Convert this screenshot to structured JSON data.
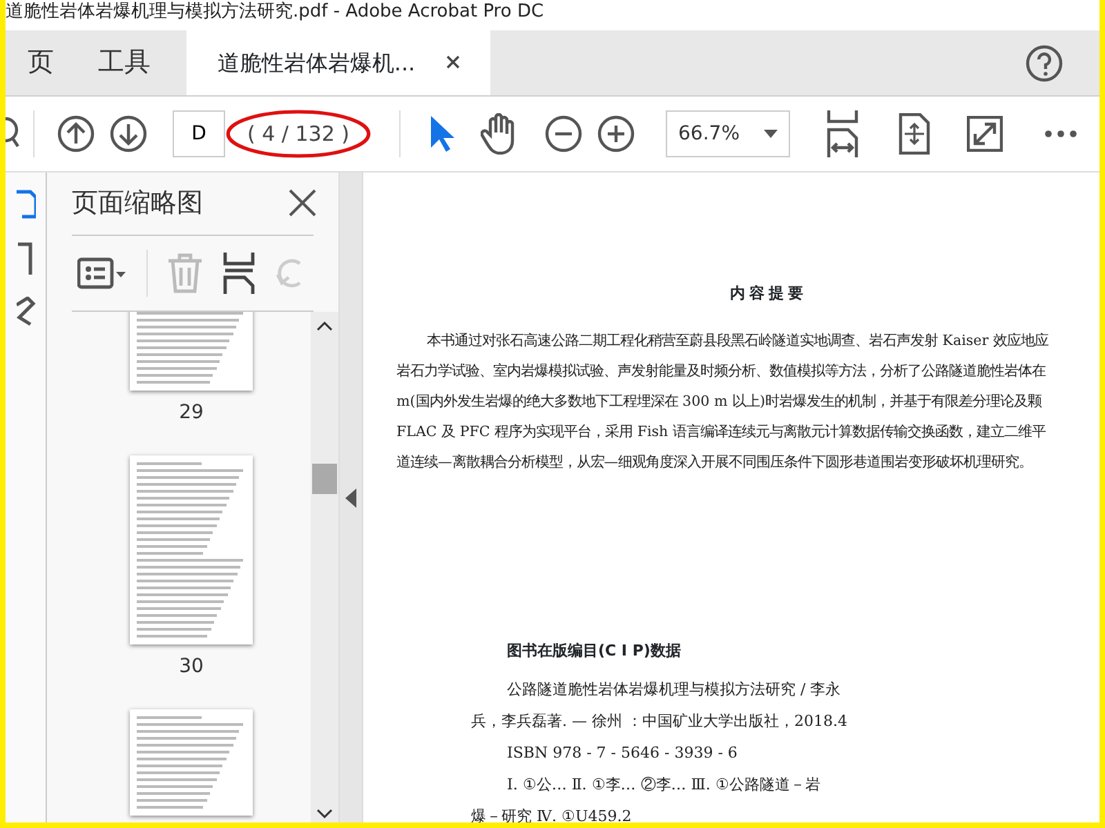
{
  "window": {
    "title": "道脆性岩体岩爆机理与模拟方法研究.pdf - Adobe Acrobat Pro DC"
  },
  "tabs": [
    {
      "label": "页",
      "kind": "nav",
      "selected": false
    },
    {
      "label": "工具",
      "kind": "nav",
      "selected": false
    },
    {
      "label": "道脆性岩体岩爆机...",
      "kind": "document",
      "selected": true
    }
  ],
  "toolbar": {
    "page_field": {
      "value": "D"
    },
    "page_count": "( 4 / 132 )",
    "zoom": "66.7%"
  },
  "sidebar": {
    "title": "页面缩略图",
    "thumbnails": [
      {
        "label": "29",
        "selected": false
      },
      {
        "label": "30",
        "selected": false
      }
    ]
  },
  "document": {
    "heading": "内容提要",
    "paragraph": [
      "本书通过对张石高速公路二期工程化稍营至蔚县段黑石岭隧道实地调查、岩石声发射 Kaiser 效应地应",
      "岩石力学试验、室内岩爆模拟试验、声发射能量及时频分析、数值模拟等方法，分析了公路隧道脆性岩体在",
      "m(国内外发生岩爆的绝大多数地下工程埋深在 300 m 以上)时岩爆发生的机制，并基于有限差分理论及颗",
      "FLAC 及 PFC 程序为实现平台，采用 Fish 语言编译连续元与离散元计算数据传输交换函数，建立二维平",
      "道连续—离散耦合分析模型，从宏—细观角度深入开展不同围压条件下圆形巷道围岩变形破坏机理研究。"
    ],
    "cip_heading": "图书在版编目(C I P)数据",
    "cip_lines": [
      {
        "text": "公路隧道脆性岩体岩爆机理与模拟方法研究 / 李永",
        "indent": true
      },
      {
        "text": "兵，李兵磊著. — 徐州 ：中国矿业大学出版社，2018.4",
        "indent": false
      },
      {
        "text": "ISBN 978 - 7 - 5646 - 3939 - 6",
        "indent": true
      },
      {
        "text": "Ⅰ. ①公…    Ⅱ. ①李…    ②李…    Ⅲ. ①公路隧道－岩",
        "indent": true
      },
      {
        "text": "爆－研究    Ⅳ. ①U459.2",
        "indent": false
      }
    ]
  }
}
